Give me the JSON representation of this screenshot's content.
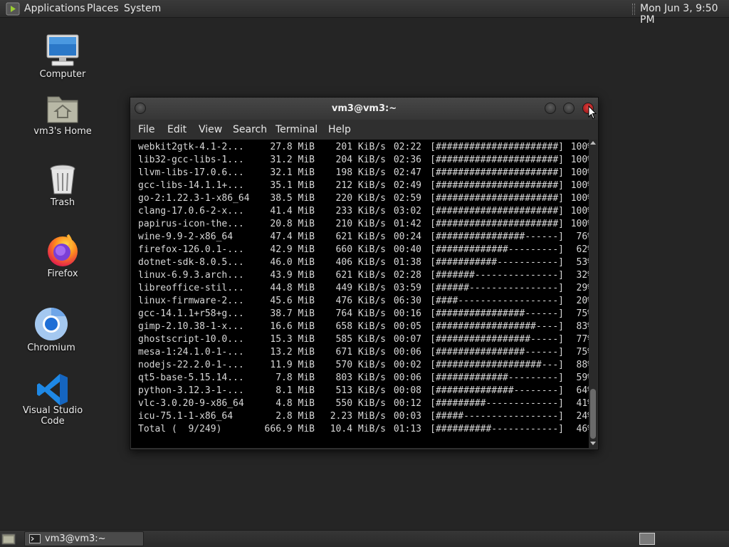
{
  "top_panel": {
    "menus": [
      "Applications",
      "Places",
      "System"
    ],
    "clock": "Mon Jun  3,  9:50 PM"
  },
  "desktop": {
    "icons": [
      {
        "label": "Computer",
        "icon": "monitor-icon"
      },
      {
        "label": "vm3's Home",
        "icon": "home-folder-icon"
      },
      {
        "label": "Trash",
        "icon": "trash-icon"
      },
      {
        "label": "Firefox",
        "icon": "firefox-icon"
      },
      {
        "label": "Chromium",
        "icon": "chromium-icon"
      },
      {
        "label": "Visual Studio Code",
        "icon": "vscode-icon"
      }
    ]
  },
  "terminal": {
    "title": "vm3@vm3:~",
    "menu": [
      "File",
      "Edit",
      "View",
      "Search",
      "Terminal",
      "Help"
    ],
    "rows": [
      {
        "name": "webkit2gtk-4.1-2...",
        "size": "27.8 MiB",
        "rate": "201 KiB/s",
        "time": "02:22",
        "bar": "[######################]",
        "pct": "100%"
      },
      {
        "name": "lib32-gcc-libs-1...",
        "size": "31.2 MiB",
        "rate": "204 KiB/s",
        "time": "02:36",
        "bar": "[######################]",
        "pct": "100%"
      },
      {
        "name": "llvm-libs-17.0.6...",
        "size": "32.1 MiB",
        "rate": "198 KiB/s",
        "time": "02:47",
        "bar": "[######################]",
        "pct": "100%"
      },
      {
        "name": "gcc-libs-14.1.1+...",
        "size": "35.1 MiB",
        "rate": "212 KiB/s",
        "time": "02:49",
        "bar": "[######################]",
        "pct": "100%"
      },
      {
        "name": "go-2:1.22.3-1-x86_64",
        "size": "38.5 MiB",
        "rate": "220 KiB/s",
        "time": "02:59",
        "bar": "[######################]",
        "pct": "100%"
      },
      {
        "name": "clang-17.0.6-2-x...",
        "size": "41.4 MiB",
        "rate": "233 KiB/s",
        "time": "03:02",
        "bar": "[######################]",
        "pct": "100%"
      },
      {
        "name": "papirus-icon-the...",
        "size": "20.8 MiB",
        "rate": "210 KiB/s",
        "time": "01:42",
        "bar": "[######################]",
        "pct": "100%"
      },
      {
        "name": "wine-9.9-2-x86_64",
        "size": "47.4 MiB",
        "rate": "621 KiB/s",
        "time": "00:24",
        "bar": "[################------]",
        "pct": "76%"
      },
      {
        "name": "firefox-126.0.1-...",
        "size": "42.9 MiB",
        "rate": "660 KiB/s",
        "time": "00:40",
        "bar": "[#############---------]",
        "pct": "62%"
      },
      {
        "name": "dotnet-sdk-8.0.5...",
        "size": "46.0 MiB",
        "rate": "406 KiB/s",
        "time": "01:38",
        "bar": "[###########-----------]",
        "pct": "53%"
      },
      {
        "name": "linux-6.9.3.arch...",
        "size": "43.9 MiB",
        "rate": "621 KiB/s",
        "time": "02:28",
        "bar": "[#######---------------]",
        "pct": "32%"
      },
      {
        "name": "libreoffice-stil...",
        "size": "44.8 MiB",
        "rate": "449 KiB/s",
        "time": "03:59",
        "bar": "[######----------------]",
        "pct": "29%"
      },
      {
        "name": "linux-firmware-2...",
        "size": "45.6 MiB",
        "rate": "476 KiB/s",
        "time": "06:30",
        "bar": "[####------------------]",
        "pct": "20%"
      },
      {
        "name": "gcc-14.1.1+r58+g...",
        "size": "38.7 MiB",
        "rate": "764 KiB/s",
        "time": "00:16",
        "bar": "[################------]",
        "pct": "75%"
      },
      {
        "name": "gimp-2.10.38-1-x...",
        "size": "16.6 MiB",
        "rate": "658 KiB/s",
        "time": "00:05",
        "bar": "[##################----]",
        "pct": "83%"
      },
      {
        "name": "ghostscript-10.0...",
        "size": "15.3 MiB",
        "rate": "585 KiB/s",
        "time": "00:07",
        "bar": "[#################-----]",
        "pct": "77%"
      },
      {
        "name": "mesa-1:24.1.0-1-...",
        "size": "13.2 MiB",
        "rate": "671 KiB/s",
        "time": "00:06",
        "bar": "[################------]",
        "pct": "75%"
      },
      {
        "name": "nodejs-22.2.0-1-...",
        "size": "11.9 MiB",
        "rate": "570 KiB/s",
        "time": "00:02",
        "bar": "[###################---]",
        "pct": "88%"
      },
      {
        "name": "qt5-base-5.15.14...",
        "size": "7.8 MiB",
        "rate": "803 KiB/s",
        "time": "00:06",
        "bar": "[#############---------]",
        "pct": "59%"
      },
      {
        "name": "python-3.12.3-1-...",
        "size": "8.1 MiB",
        "rate": "513 KiB/s",
        "time": "00:08",
        "bar": "[##############--------]",
        "pct": "64%"
      },
      {
        "name": "vlc-3.0.20-9-x86_64",
        "size": "4.8 MiB",
        "rate": "550 KiB/s",
        "time": "00:12",
        "bar": "[#########-------------]",
        "pct": "41%"
      },
      {
        "name": "icu-75.1-1-x86_64",
        "size": "2.8 MiB",
        "rate": "2.23 MiB/s",
        "time": "00:03",
        "bar": "[#####-----------------]",
        "pct": "24%"
      },
      {
        "name": "Total (  9/249)",
        "size": "666.9 MiB",
        "rate": "10.4 MiB/s",
        "time": "01:13",
        "bar": "[##########------------]",
        "pct": "46%"
      }
    ]
  },
  "taskbar": {
    "window_button": "vm3@vm3:~"
  },
  "colors": {
    "desktop_bg": "#252525",
    "terminal_bg": "#000000",
    "terminal_fg": "#d8d8d8",
    "close_button": "#d32f2f"
  }
}
